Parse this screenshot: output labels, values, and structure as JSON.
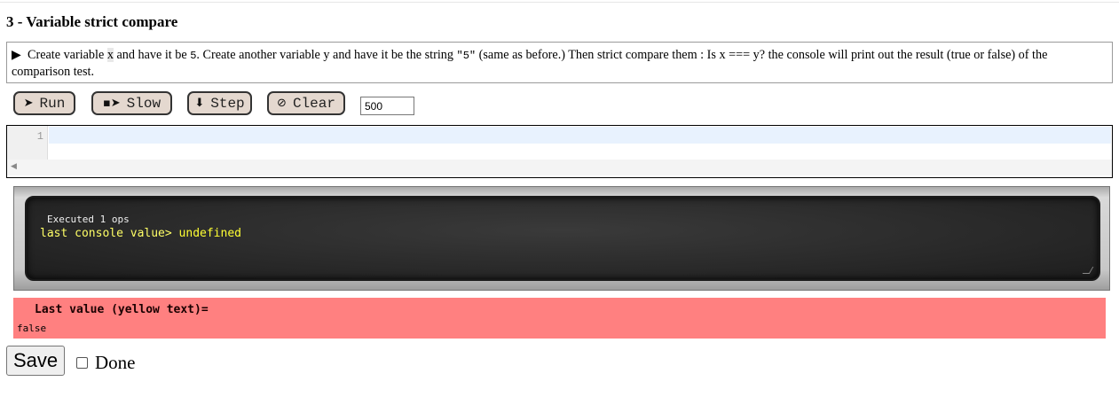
{
  "exercise": {
    "title": "3 - Variable strict compare",
    "toggle_icon": "▶",
    "instr_part1": "Create variable ",
    "instr_var_x": "x",
    "instr_part2": " and have it be ",
    "instr_num_5": "5",
    "instr_part3": ". Create another variable y and have it be the string ",
    "instr_str_5": "\"5\"",
    "instr_part4": " (same as before.) Then strict compare them : Is x === y? the console will print out the result (true or false) of the comparison test."
  },
  "controls": {
    "run_label": "Run",
    "slow_label": "Slow",
    "step_label": "Step",
    "clear_label": "Clear",
    "run_icon": "➤",
    "slow_icon": "▪➤",
    "step_icon": "⬇",
    "clear_icon": "⊘",
    "speed_value": "500"
  },
  "editor": {
    "line_number": "1",
    "code": ""
  },
  "console": {
    "executed": "Executed 1 ops",
    "prompt": "last console value>",
    "value": "undefined"
  },
  "result": {
    "label": "Last value (yellow text)=",
    "value": "false"
  },
  "footer": {
    "save_label": "Save",
    "done_label": "Done"
  },
  "colors": {
    "result_bg": "#ff8080",
    "console_text": "#ffff33",
    "button_bg": "#e4d8cf"
  }
}
